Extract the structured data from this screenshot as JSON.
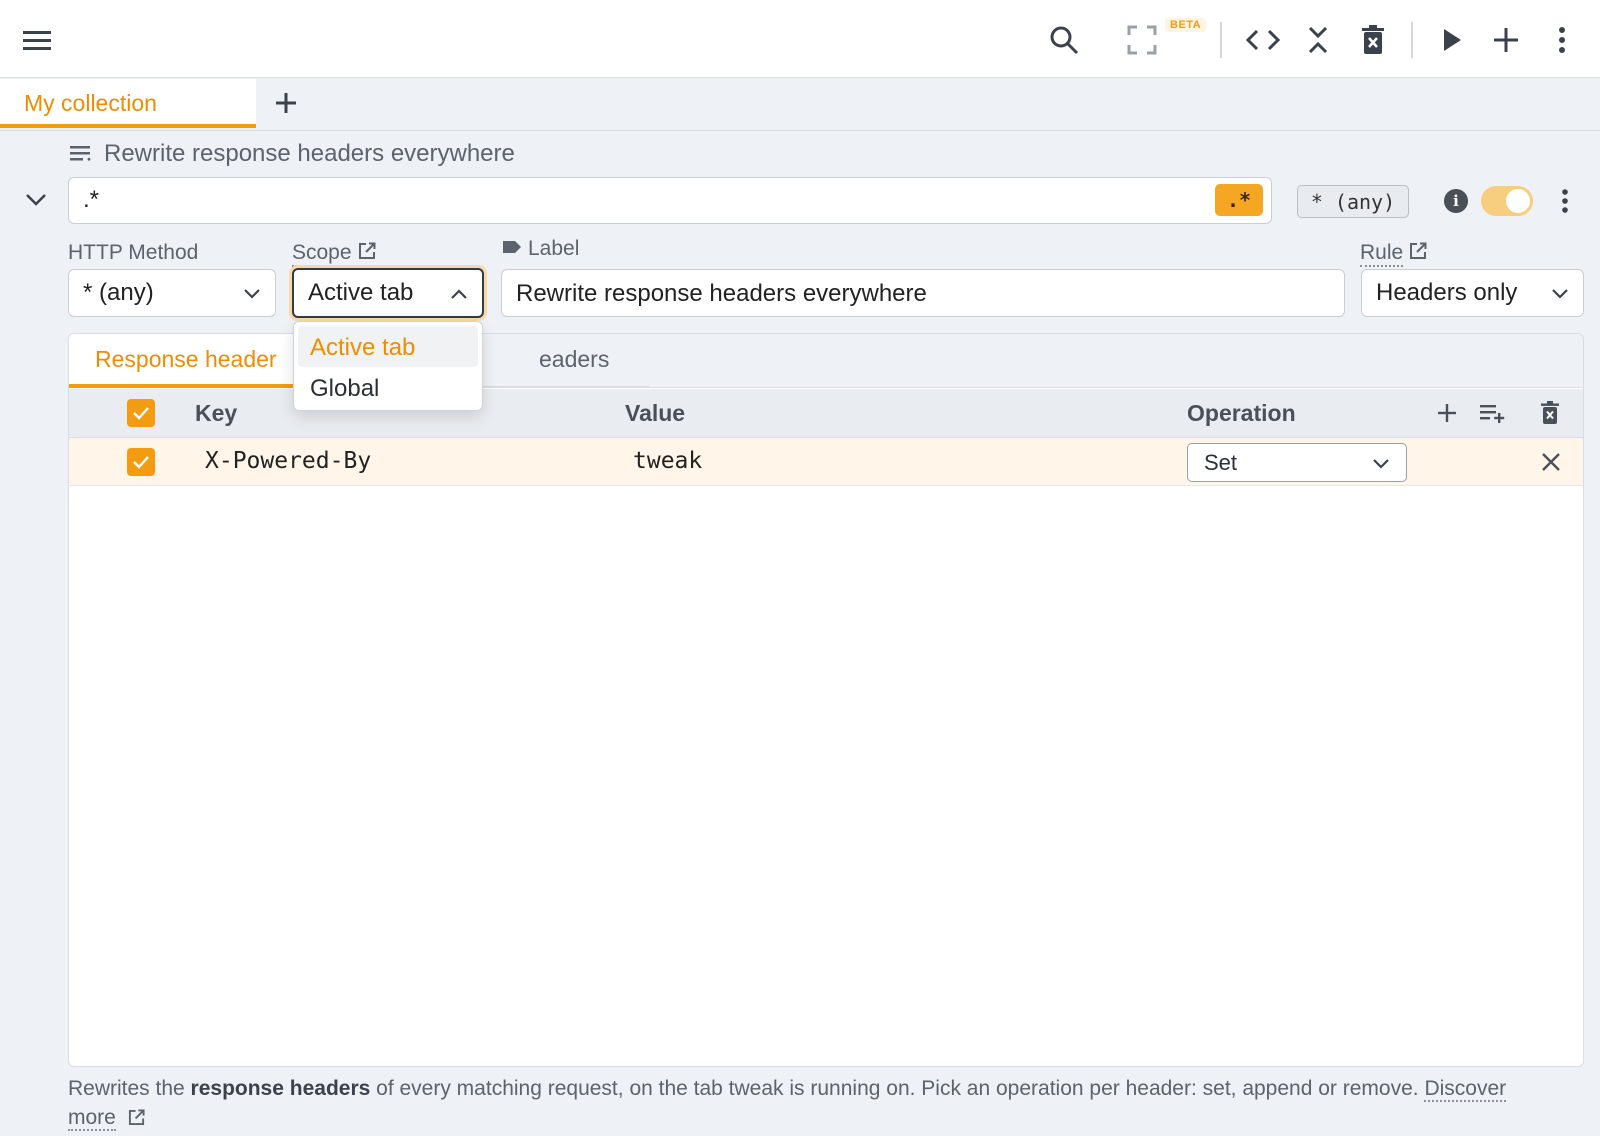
{
  "toolbar": {
    "buttons": [
      "menu-icon",
      "search-icon",
      "fullscreen-icon",
      "code-icon",
      "collapse-all-icon",
      "delete-icon",
      "run-icon",
      "add-icon",
      "more-icon"
    ],
    "beta_badge": "BETA"
  },
  "tabs": {
    "collection_label": "My collection",
    "add_label": "+"
  },
  "rule": {
    "title": "Rewrite response headers everywhere",
    "url_pattern": ".*",
    "regex_badge": ".*",
    "method_badge": "* (any)",
    "enabled": true
  },
  "fields": {
    "http_method_label": "HTTP Method",
    "http_method_value": "* (any)",
    "scope_label": "Scope",
    "scope_value": "Active tab",
    "label_label": "Label",
    "label_value": "Rewrite response headers everywhere",
    "rule_label": "Rule",
    "rule_value": "Headers only"
  },
  "scope_dropdown": {
    "options": [
      "Active tab",
      "Global"
    ],
    "selected": "Active tab"
  },
  "subtabs": {
    "active": "Response header",
    "inactive": "eaders"
  },
  "table": {
    "headers": {
      "key": "Key",
      "value": "Value",
      "operation": "Operation"
    },
    "rows": [
      {
        "key": "X-Powered-By",
        "value": "tweak",
        "operation": "Set",
        "checked": true
      }
    ]
  },
  "footer": {
    "text_prefix": "Rewrites the ",
    "bold": "response headers",
    "text_suffix": " of every matching request, on the tab tweak is running on. Pick an operation per header: set, append or remove. ",
    "link": "Discover more"
  },
  "colors": {
    "accent": "#f39c12",
    "accent_text": "#f08c00",
    "row_highlight": "#fff6e9"
  }
}
